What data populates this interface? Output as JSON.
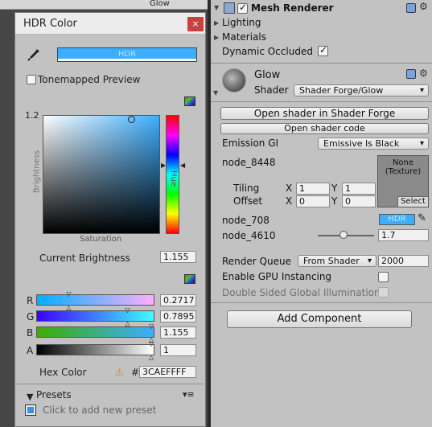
{
  "background": {
    "title": "Glow"
  },
  "hdr_window": {
    "title": "HDR Color",
    "close_icon": "×",
    "hdr_label": "HDR",
    "current_color": "#3CAEFF",
    "tonemapped_label": "Tonemapped Preview",
    "tonemapped_checked": false,
    "brightness_max": "1.2",
    "axis_brightness": "Brightness",
    "axis_saturation": "Saturation",
    "axis_hue": "Hue",
    "current_brightness_label": "Current Brightness",
    "current_brightness_value": "1.155",
    "channels": [
      {
        "label": "R",
        "value": "0.2717",
        "fraction": 0.2717
      },
      {
        "label": "G",
        "value": "0.7895",
        "fraction": 0.7895
      },
      {
        "label": "B",
        "value": "1.155",
        "fraction": 1.0
      },
      {
        "label": "A",
        "value": "1",
        "fraction": 1.0
      }
    ],
    "hex_label": "Hex Color",
    "hex_hash": "#",
    "hex_value": "3CAEFFFF",
    "presets_label": "Presets",
    "presets_hint": "Click to add new preset"
  },
  "inspector": {
    "component_title": "Mesh Renderer",
    "lighting_label": "Lighting",
    "materials_label": "Materials",
    "dynamic_occluded_label": "Dynamic Occluded",
    "dynamic_occluded_checked": true,
    "material_name": "Glow",
    "shader_label": "Shader",
    "shader_value": "Shader Forge/Glow",
    "open_forge_button": "Open shader in Shader Forge",
    "open_code_button": "Open shader code",
    "emission_gi_label": "Emission GI",
    "emission_gi_value": "Emissive Is Black",
    "node_8448_label": "node_8448",
    "texture_none": "None",
    "texture_type": "(Texture)",
    "texture_select": "Select",
    "tiling_label": "Tiling",
    "offset_label": "Offset",
    "x_label": "X",
    "y_label": "Y",
    "tiling_x": "1",
    "tiling_y": "1",
    "offset_x": "0",
    "offset_y": "0",
    "node_708_label": "node_708",
    "node_708_hdr": "HDR",
    "node_4610_label": "node_4610",
    "node_4610_value": "1.7",
    "node_4610_fraction": 0.45,
    "render_queue_label": "Render Queue",
    "render_queue_mode": "From Shader",
    "render_queue_value": "2000",
    "gpu_instancing_label": "Enable GPU Instancing",
    "gpu_instancing_checked": false,
    "double_sided_label": "Double Sided Global Illumination",
    "double_sided_checked": false,
    "add_component_button": "Add Component"
  }
}
